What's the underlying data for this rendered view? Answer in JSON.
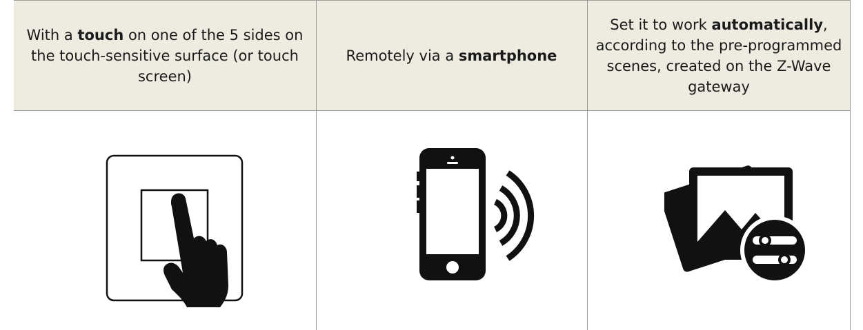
{
  "columns": [
    {
      "text_before": "With a ",
      "bold": "touch",
      "text_after": " on one of the 5 sides on the touch-sensitive surface (or touch screen)",
      "icon": "touch-panel-hand-icon"
    },
    {
      "text_before": "Remotely via a ",
      "bold": "smartphone",
      "text_after": "",
      "icon": "smartphone-wireless-icon"
    },
    {
      "text_before": "Set it to work ",
      "bold": "automatically",
      "text_after": ", according to the pre-programmed scenes, created on the Z-Wave gateway",
      "icon": "scenes-gallery-settings-icon"
    }
  ],
  "colors": {
    "header_background": "#eeece1",
    "border": "#9a9a9a",
    "icon": "#111111"
  }
}
